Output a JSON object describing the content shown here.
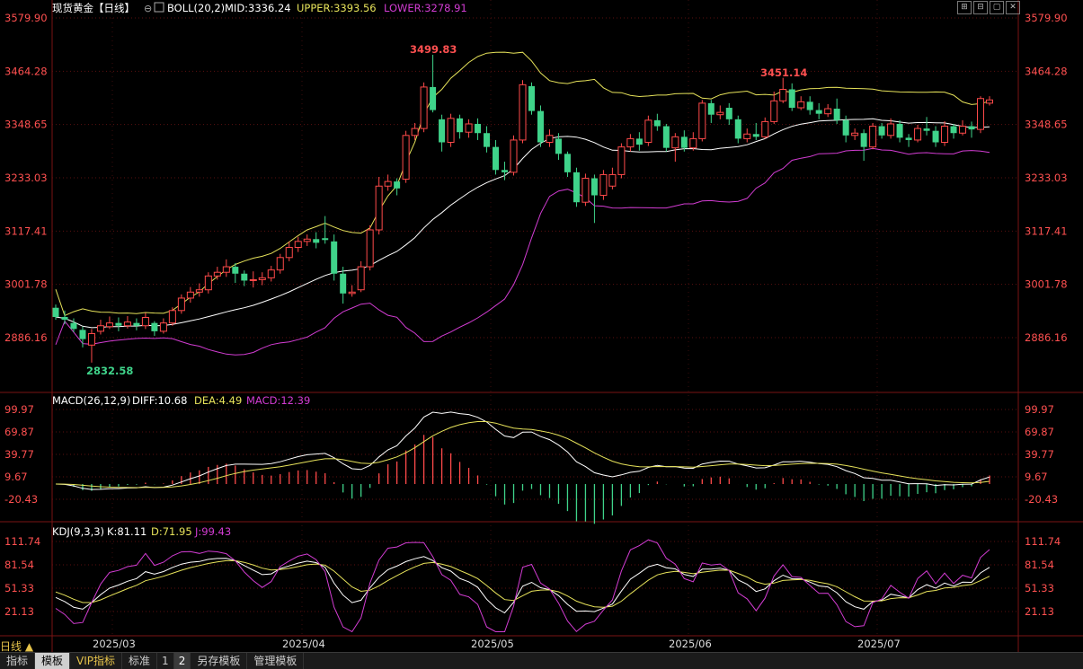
{
  "header": {
    "title": "现货黄金【日线】",
    "boll_label": "BOLL(20,2)",
    "mid": "MID:3336.24",
    "upper": "UPPER:3393.56",
    "lower": "LOWER:3278.91"
  },
  "window_buttons": [
    "⊞",
    "⊟",
    "▢",
    "✕"
  ],
  "price_axis": {
    "ticks": [
      "3579.90",
      "3464.28",
      "3348.65",
      "3233.03",
      "3117.41",
      "3001.78",
      "2886.16"
    ],
    "values": [
      3579.9,
      3464.28,
      3348.65,
      3233.03,
      3117.41,
      3001.78,
      2886.16
    ]
  },
  "annotations": {
    "high1": "3499.83",
    "high2": "3451.14",
    "low1": "2832.58"
  },
  "macd": {
    "label": "MACD(26,12,9)",
    "diff": "DIFF:10.68",
    "dea": "DEA:4.49",
    "macd": "MACD:12.39",
    "ticks": [
      "99.97",
      "69.87",
      "39.77",
      "9.67",
      "-20.43"
    ],
    "values": [
      99.97,
      69.87,
      39.77,
      9.67,
      -20.43
    ]
  },
  "kdj": {
    "label": "KDJ(9,3,3)",
    "k": "K:81.11",
    "d": "D:71.95",
    "j": "J:99.43",
    "ticks": [
      "111.74",
      "81.54",
      "51.33",
      "21.13"
    ],
    "values": [
      111.74,
      81.54,
      51.33,
      21.13
    ]
  },
  "time_axis": [
    "2025/03",
    "2025/04",
    "2025/05",
    "2025/06",
    "2025/07"
  ],
  "period_tag": "日线 ▲",
  "bottom_bar": {
    "items": [
      "指标",
      "模板",
      "VIP指标",
      "标准",
      "1",
      "2",
      "另存模板",
      "管理模板"
    ]
  },
  "colors": {
    "up": "#ff4a4a",
    "down": "#3fd38a",
    "mid": "#ffffff",
    "upper": "#e6e25a",
    "lower": "#d23cd2",
    "axis_text": "#ff5050"
  },
  "chart_data": [
    {
      "type": "candlestick",
      "title": "现货黄金【日线】",
      "x": [
        "2025/03",
        "2025/04",
        "2025/05",
        "2025/06",
        "2025/07"
      ],
      "ylim": [
        2886.16,
        3579.9
      ],
      "candles": [
        [
          2951,
          2931,
          2958,
          2925
        ],
        [
          2931,
          2925,
          2945,
          2915
        ],
        [
          2918,
          2905,
          2928,
          2898
        ],
        [
          2903,
          2883,
          2910,
          2865
        ],
        [
          2870,
          2895,
          2905,
          2832
        ],
        [
          2900,
          2912,
          2925,
          2893
        ],
        [
          2910,
          2918,
          2932,
          2905
        ],
        [
          2918,
          2912,
          2930,
          2900
        ],
        [
          2912,
          2920,
          2933,
          2906
        ],
        [
          2918,
          2912,
          2928,
          2902
        ],
        [
          2912,
          2930,
          2940,
          2905
        ],
        [
          2918,
          2900,
          2922,
          2890
        ],
        [
          2900,
          2918,
          2928,
          2895
        ],
        [
          2918,
          2945,
          2952,
          2912
        ],
        [
          2945,
          2972,
          2980,
          2938
        ],
        [
          2972,
          2985,
          2996,
          2962
        ],
        [
          2985,
          2990,
          3004,
          2975
        ],
        [
          2990,
          3020,
          3028,
          2982
        ],
        [
          3020,
          3028,
          3040,
          3012
        ],
        [
          3028,
          3040,
          3056,
          3018
        ],
        [
          3040,
          3025,
          3048,
          3005
        ],
        [
          3025,
          3010,
          3032,
          2998
        ],
        [
          3010,
          3012,
          3030,
          2995
        ],
        [
          3012,
          3016,
          3028,
          3000
        ],
        [
          3016,
          3033,
          3042,
          3008
        ],
        [
          3033,
          3060,
          3068,
          3025
        ],
        [
          3060,
          3082,
          3095,
          3052
        ],
        [
          3082,
          3095,
          3105,
          3072
        ],
        [
          3095,
          3100,
          3110,
          3085
        ],
        [
          3100,
          3092,
          3115,
          3080
        ],
        [
          3102,
          3098,
          3150,
          3090
        ],
        [
          3095,
          3025,
          3110,
          3010
        ],
        [
          3025,
          2982,
          3040,
          2960
        ],
        [
          2982,
          2985,
          3000,
          2975
        ],
        [
          2990,
          3040,
          3052,
          2985
        ],
        [
          3040,
          3120,
          3130,
          3032
        ],
        [
          3120,
          3215,
          3235,
          3110
        ],
        [
          3215,
          3225,
          3240,
          3205
        ],
        [
          3225,
          3210,
          3232,
          3195
        ],
        [
          3230,
          3325,
          3335,
          3222
        ],
        [
          3325,
          3340,
          3352,
          3315
        ],
        [
          3340,
          3430,
          3440,
          3332
        ],
        [
          3430,
          3380,
          3500,
          3375
        ],
        [
          3360,
          3310,
          3370,
          3290
        ],
        [
          3310,
          3362,
          3372,
          3300
        ],
        [
          3362,
          3332,
          3370,
          3318
        ],
        [
          3332,
          3350,
          3360,
          3320
        ],
        [
          3350,
          3330,
          3362,
          3315
        ],
        [
          3330,
          3300,
          3345,
          3288
        ],
        [
          3300,
          3250,
          3315,
          3240
        ],
        [
          3250,
          3245,
          3268,
          3228
        ],
        [
          3245,
          3315,
          3325,
          3238
        ],
        [
          3315,
          3435,
          3445,
          3308
        ],
        [
          3432,
          3378,
          3440,
          3370
        ],
        [
          3378,
          3310,
          3390,
          3300
        ],
        [
          3310,
          3325,
          3338,
          3300
        ],
        [
          3318,
          3285,
          3330,
          3272
        ],
        [
          3285,
          3245,
          3290,
          3235
        ],
        [
          3245,
          3180,
          3255,
          3170
        ],
        [
          3180,
          3232,
          3242,
          3172
        ],
        [
          3232,
          3195,
          3240,
          3135
        ],
        [
          3195,
          3240,
          3250,
          3185
        ],
        [
          3215,
          3240,
          3255,
          3208
        ],
        [
          3240,
          3300,
          3308,
          3232
        ],
        [
          3300,
          3318,
          3328,
          3290
        ],
        [
          3318,
          3305,
          3332,
          3292
        ],
        [
          3310,
          3358,
          3368,
          3302
        ],
        [
          3358,
          3345,
          3372,
          3335
        ],
        [
          3345,
          3298,
          3350,
          3290
        ],
        [
          3298,
          3322,
          3330,
          3268
        ],
        [
          3322,
          3298,
          3336,
          3290
        ],
        [
          3298,
          3318,
          3332,
          3292
        ],
        [
          3318,
          3395,
          3402,
          3312
        ],
        [
          3395,
          3370,
          3402,
          3352
        ],
        [
          3370,
          3375,
          3390,
          3360
        ],
        [
          3385,
          3360,
          3395,
          3348
        ],
        [
          3360,
          3318,
          3368,
          3308
        ],
        [
          3318,
          3328,
          3340,
          3310
        ],
        [
          3328,
          3322,
          3352,
          3315
        ],
        [
          3322,
          3355,
          3364,
          3318
        ],
        [
          3355,
          3400,
          3420,
          3350
        ],
        [
          3400,
          3425,
          3450,
          3395
        ],
        [
          3425,
          3385,
          3438,
          3378
        ],
        [
          3385,
          3398,
          3410,
          3380
        ],
        [
          3398,
          3380,
          3410,
          3370
        ],
        [
          3380,
          3372,
          3395,
          3360
        ],
        [
          3372,
          3383,
          3393,
          3365
        ],
        [
          3383,
          3358,
          3405,
          3350
        ],
        [
          3358,
          3325,
          3368,
          3310
        ],
        [
          3325,
          3330,
          3340,
          3315
        ],
        [
          3330,
          3300,
          3338,
          3270
        ],
        [
          3300,
          3345,
          3352,
          3295
        ],
        [
          3345,
          3325,
          3352,
          3318
        ],
        [
          3325,
          3350,
          3362,
          3318
        ],
        [
          3350,
          3320,
          3358,
          3310
        ],
        [
          3320,
          3315,
          3328,
          3300
        ],
        [
          3315,
          3340,
          3348,
          3310
        ],
        [
          3340,
          3335,
          3365,
          3325
        ],
        [
          3335,
          3310,
          3345,
          3300
        ],
        [
          3310,
          3345,
          3356,
          3302
        ],
        [
          3345,
          3330,
          3350,
          3318
        ],
        [
          3330,
          3345,
          3358,
          3325
        ],
        [
          3345,
          3338,
          3355,
          3320
        ],
        [
          3338,
          3405,
          3410,
          3330
        ],
        [
          3395,
          3402,
          3410,
          3390
        ]
      ]
    }
  ]
}
